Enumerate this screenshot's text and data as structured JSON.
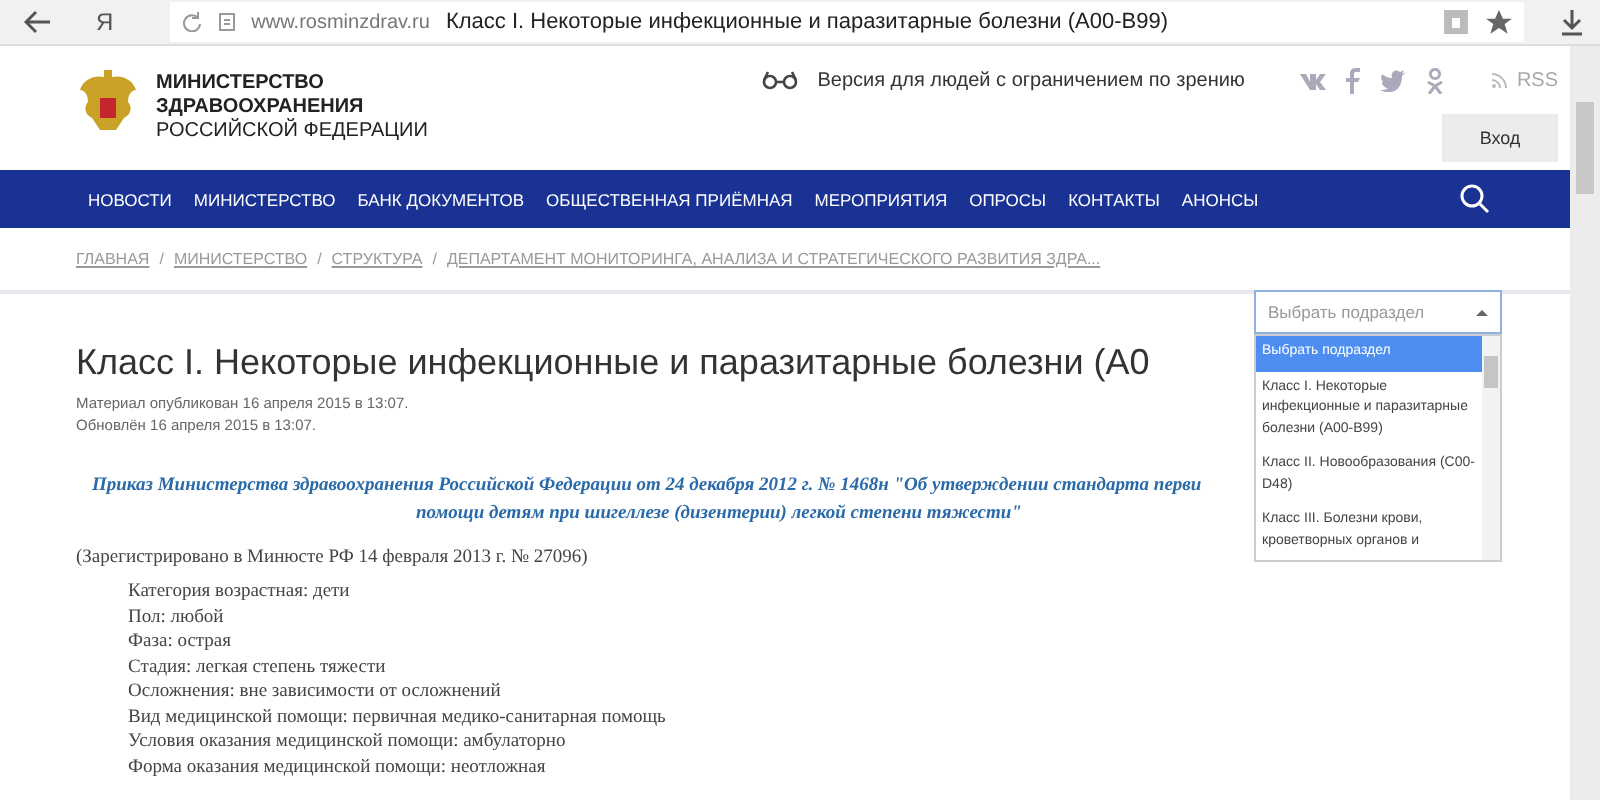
{
  "browser": {
    "url": "www.rosminzdrav.ru",
    "page_title": "Класс I. Некоторые инфекционные и паразитарные болезни (A00-B99)",
    "logo": "Я"
  },
  "header": {
    "org_lines": [
      "МИНИСТЕРСТВО",
      "ЗДРАВООХРАНЕНИЯ",
      "РОССИЙСКОЙ ФЕДЕРАЦИИ"
    ],
    "accessibility": "Версия для людей с ограничением по зрению",
    "rss": "RSS",
    "login": "Вход"
  },
  "nav": [
    "НОВОСТИ",
    "МИНИСТЕРСТВО",
    "БАНК ДОКУМЕНТОВ",
    "ОБЩЕСТВЕННАЯ ПРИЁМНАЯ",
    "МЕРОПРИЯТИЯ",
    "ОПРОСЫ",
    "КОНТАКТЫ",
    "АНОНСЫ"
  ],
  "breadcrumb_separator": "/",
  "breadcrumbs": [
    "ГЛАВНАЯ",
    "МИНИСТЕРСТВО",
    "СТРУКТУРА",
    "ДЕПАРТАМЕНТ МОНИТОРИНГА, АНАЛИЗА И СТРАТЕГИЧЕСКОГО РАЗВИТИЯ ЗДРА..."
  ],
  "section_select": {
    "placeholder": "Выбрать подраздел",
    "expanded": true,
    "options": [
      {
        "label": "Выбрать подраздел",
        "selected": true
      },
      {
        "label": "Класс I. Некоторые инфекционные и паразитарные болезни (A00-B99)",
        "selected": false
      },
      {
        "label": "Класс II. Новообразования (C00-D48)",
        "selected": false
      },
      {
        "label": "Класс III. Болезни крови, кроветворных органов и",
        "selected": false
      }
    ]
  },
  "article": {
    "title": "Класс I. Некоторые инфекционные и паразитарные болезни (A0",
    "meta": [
      "Материал опубликован 16 апреля 2015 в 13:07.",
      "Обновлён 16 апреля 2015 в 13:07."
    ],
    "order_lines": [
      "Приказ Министерства здравоохранения Российской Федерации от 24 декабря 2012 г. № 1468н \"Об утверждении стандарта перви",
      "помощи детям при шигеллезе (дизентерии) легкой степени тяжести\""
    ],
    "registered": "(Зарегистрировано в Минюсте РФ 14 февраля 2013 г. № 27096)",
    "items": [
      "Категория возрастная: дети",
      "Пол: любой",
      "Фаза: острая",
      "Стадия: легкая степень тяжести",
      "Осложнения: вне зависимости от осложнений",
      "Вид медицинской помощи: первичная медико-санитарная помощь",
      "Условия оказания медицинской помощи: амбулаторно",
      "Форма оказания медицинской помощи: неотложная"
    ]
  }
}
